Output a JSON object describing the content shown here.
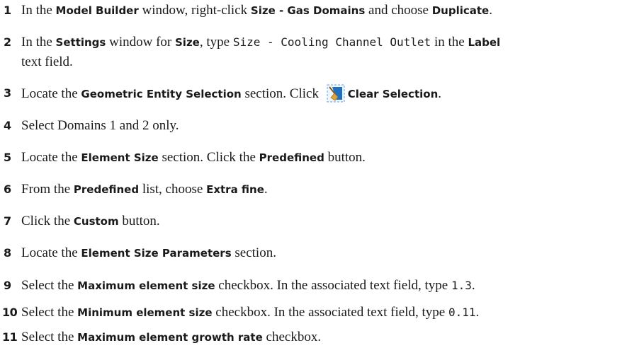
{
  "steps": [
    {
      "num": "1",
      "parts": [
        "In the ",
        "Model Builder",
        " window, right-click ",
        "Size - Gas Domains",
        " and choose ",
        "Duplicate",
        "."
      ]
    },
    {
      "num": "2",
      "parts": [
        "In the ",
        "Settings",
        " window for ",
        "Size",
        ", type ",
        "Size - Cooling Channel Outlet",
        " in the ",
        "Label"
      ],
      "wrap": "text field."
    },
    {
      "num": "3",
      "parts": [
        "Locate the ",
        "Geometric Entity Selection",
        " section. Click ",
        "Clear Selection",
        "."
      ],
      "icon": "clear-selection-icon"
    },
    {
      "num": "4",
      "parts": [
        "Select Domains 1 and 2 only."
      ]
    },
    {
      "num": "5",
      "parts": [
        "Locate the ",
        "Element Size",
        " section. Click the ",
        "Predefined",
        " button."
      ]
    },
    {
      "num": "6",
      "parts": [
        "From the ",
        "Predefined",
        " list, choose ",
        "Extra fine",
        "."
      ]
    },
    {
      "num": "7",
      "parts": [
        "Click the ",
        "Custom",
        " button."
      ]
    },
    {
      "num": "8",
      "parts": [
        "Locate the ",
        "Element Size Parameters",
        " section."
      ]
    },
    {
      "num": "9",
      "parts": [
        "Select the ",
        "Maximum element size",
        " checkbox. In the associated text field, type ",
        "1.3",
        "."
      ]
    },
    {
      "num": "10",
      "parts": [
        "Select the ",
        "Minimum element size",
        " checkbox. In the associated text field, type ",
        "0.11",
        "."
      ]
    },
    {
      "num": "11",
      "parts": [
        "Select the ",
        "Maximum element growth rate",
        " checkbox."
      ]
    }
  ],
  "colors": {
    "icon_blue": "#1f6fc2",
    "icon_frame": "#7fb3e6",
    "icon_broom": "#d9a441"
  }
}
